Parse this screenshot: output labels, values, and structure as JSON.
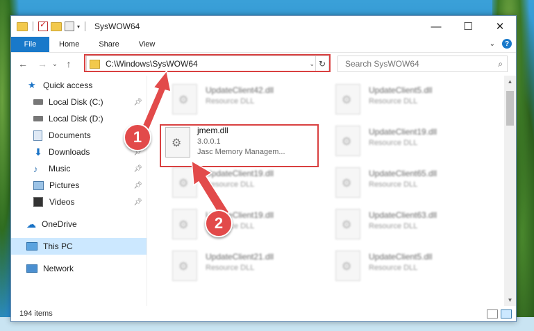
{
  "window": {
    "title": "SysWOW64"
  },
  "window_controls": {
    "minimize": "—",
    "maximize": "☐",
    "close": "✕"
  },
  "ribbon": {
    "tabs": [
      "File",
      "Home",
      "Share",
      "View"
    ],
    "collapse_glyph": "⌄",
    "help_glyph": "?"
  },
  "navigation": {
    "back_glyph": "←",
    "forward_glyph": "→",
    "recent_glyph": "⌄",
    "up_glyph": "↑",
    "address_path": "C:\\Windows\\SysWOW64",
    "refresh_glyph": "↻",
    "search_placeholder": "Search SysWOW64"
  },
  "sidebar": {
    "items": [
      {
        "label": "Quick access",
        "icon": "star-icon"
      },
      {
        "label": "Local Disk (C:)",
        "icon": "drive-icon",
        "pinned": true
      },
      {
        "label": "Local Disk (D:)",
        "icon": "drive-icon"
      },
      {
        "label": "Documents",
        "icon": "documents-icon"
      },
      {
        "label": "Downloads",
        "icon": "downloads-icon",
        "pinned": true
      },
      {
        "label": "Music",
        "icon": "music-icon",
        "pinned": true
      },
      {
        "label": "Pictures",
        "icon": "pictures-icon",
        "pinned": true
      },
      {
        "label": "Videos",
        "icon": "videos-icon",
        "pinned": true
      },
      {
        "label": "OneDrive",
        "icon": "cloud-icon"
      },
      {
        "label": "This PC",
        "icon": "computer-icon",
        "selected": true
      },
      {
        "label": "Network",
        "icon": "network-icon"
      }
    ]
  },
  "files": {
    "focused": {
      "name": "jmem.dll",
      "version": "3.0.0.1",
      "description": "Jasc Memory Managem..."
    },
    "background": [
      {
        "name": "UpdateClient42.dll",
        "type": "Resource DLL"
      },
      {
        "name": "UpdateClient5.dll",
        "type": "Resource DLL"
      },
      {
        "name": "UpdateClient19.dll",
        "type": "Resource DLL"
      },
      {
        "name": "UpdateClient19.dll",
        "type": "Resource DLL"
      },
      {
        "name": "UpdateClient65.dll",
        "type": "Resource DLL"
      },
      {
        "name": "UpdateClient19.dll",
        "type": "Resource DLL"
      },
      {
        "name": "UpdateClient63.dll",
        "type": "Resource DLL"
      },
      {
        "name": "UpdateClient21.dll",
        "type": "Resource DLL"
      },
      {
        "name": "UpdateClient5.dll",
        "type": "Resource DLL"
      }
    ]
  },
  "status": {
    "item_count": "194 items"
  },
  "annotations": {
    "step1": "1",
    "step2": "2",
    "color": "#d94040"
  }
}
